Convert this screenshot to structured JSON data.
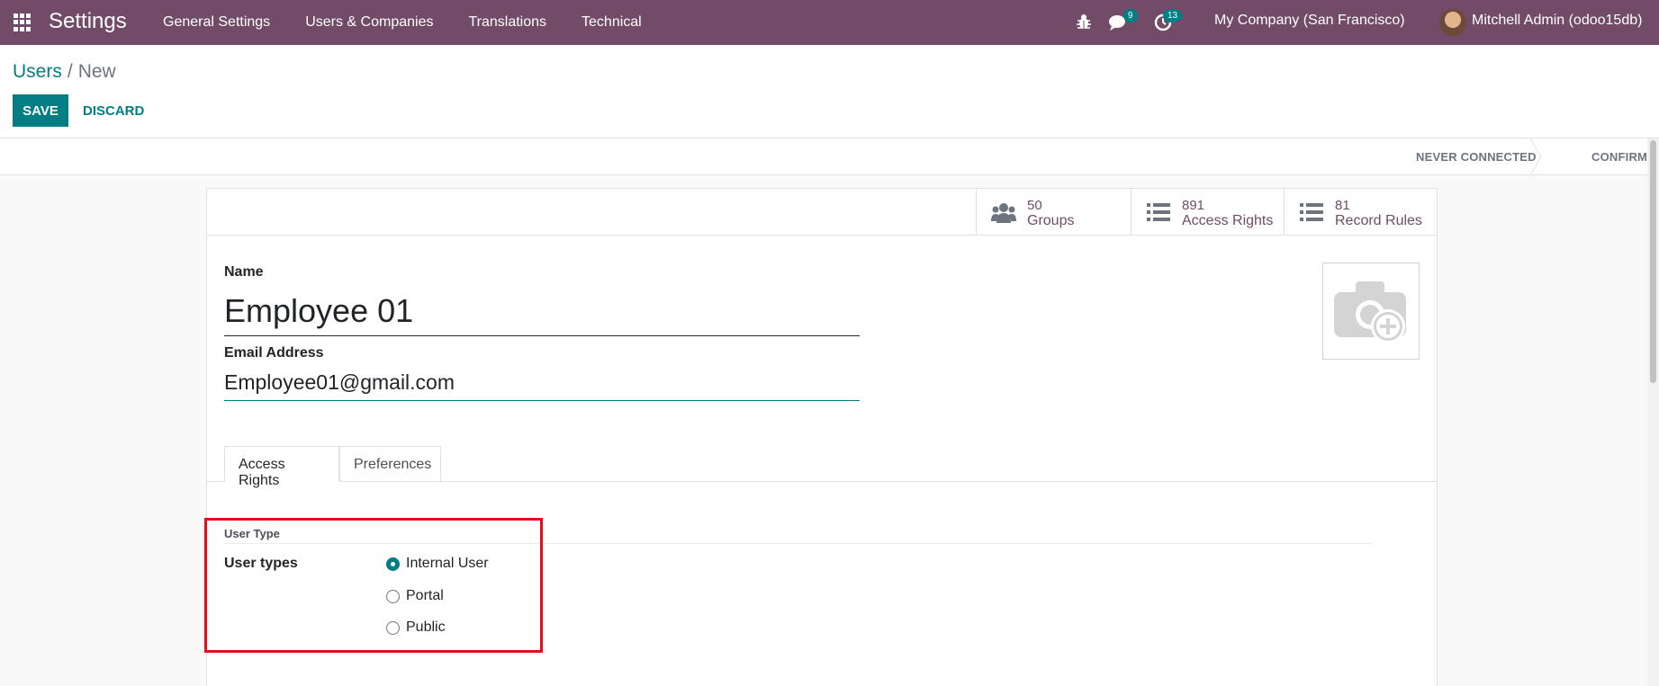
{
  "navbar": {
    "app_title": "Settings",
    "menu": [
      "General Settings",
      "Users & Companies",
      "Translations",
      "Technical"
    ],
    "messages_badge": "9",
    "activities_badge": "13",
    "company": "My Company (San Francisco)",
    "user": "Mitchell Admin (odoo15db)",
    "bg_color": "#714b67"
  },
  "breadcrumb": {
    "parent": "Users",
    "separator": "/",
    "current": "New"
  },
  "actions": {
    "save": "SAVE",
    "discard": "DISCARD"
  },
  "statusbar": {
    "states": [
      "NEVER CONNECTED",
      "CONFIRMED"
    ]
  },
  "stat_buttons": {
    "groups": {
      "value": "50",
      "label": "Groups",
      "icon": "users-icon"
    },
    "access_rights": {
      "value": "891",
      "label": "Access Rights",
      "icon": "list-icon"
    },
    "record_rules": {
      "value": "81",
      "label": "Record Rules",
      "icon": "list-icon"
    }
  },
  "form": {
    "name_label": "Name",
    "name_value": "Employee 01",
    "email_label": "Email Address",
    "email_value": "Employee01@gmail.com",
    "photo_icon": "camera-plus-icon"
  },
  "tabs": [
    "Access Rights",
    "Preferences"
  ],
  "user_type": {
    "group_title": "User Type",
    "field_label": "User types",
    "options": [
      "Internal User",
      "Portal",
      "Public"
    ],
    "selected": "Internal User"
  },
  "accent_color": "#017e84",
  "highlight_color": "#e3101c"
}
